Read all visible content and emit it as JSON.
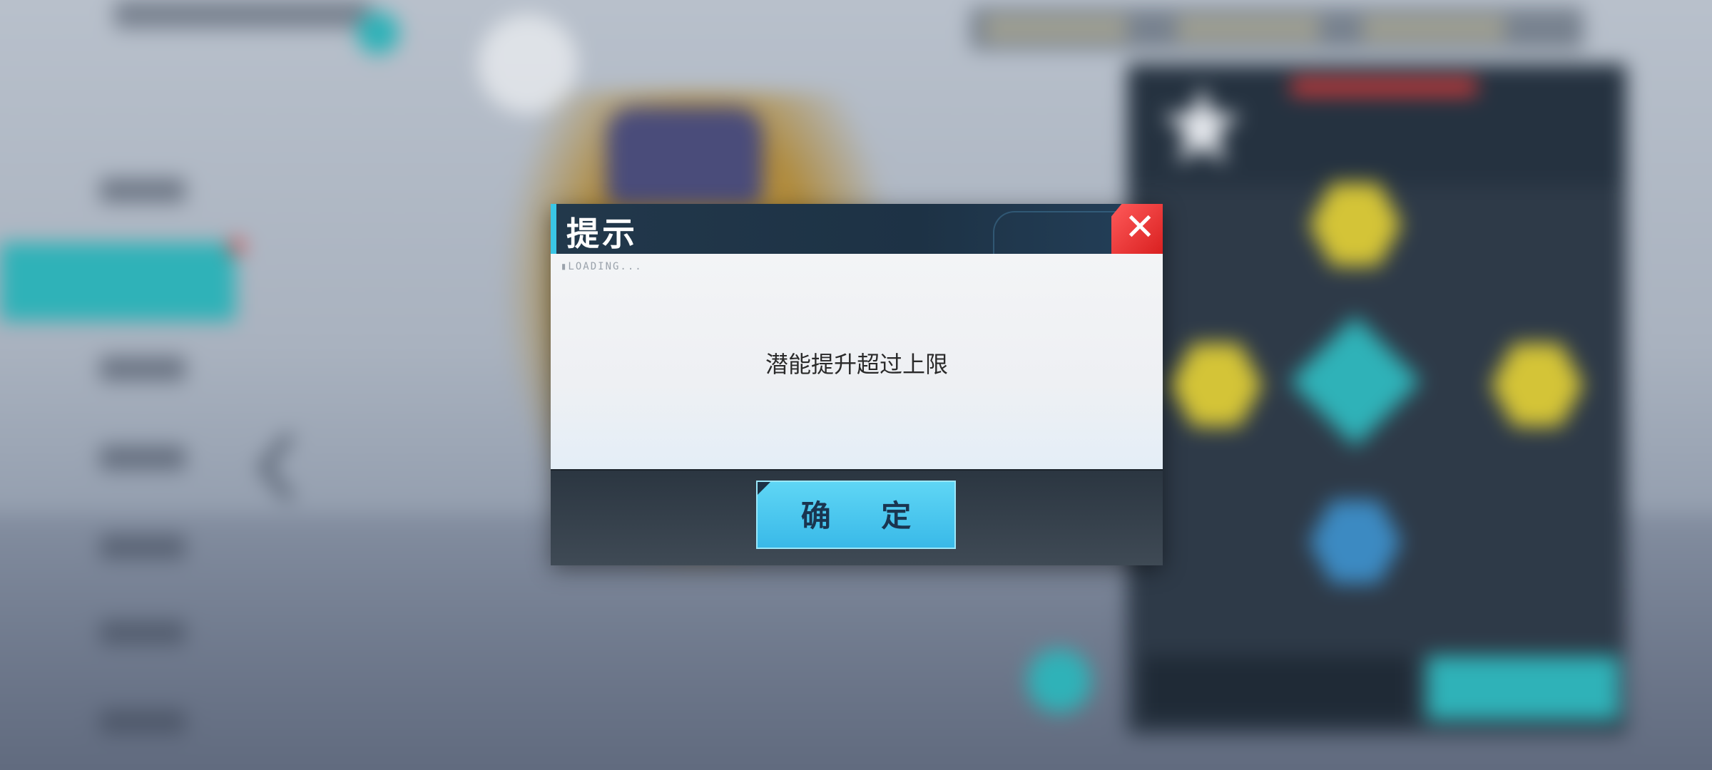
{
  "dialog": {
    "title": "提示",
    "subtitle": "",
    "loading_text": "▮LOADING...",
    "message": "潜能提升超过上限",
    "close_icon": "close-icon",
    "confirm_label": "确 定",
    "confirm_sub": ""
  },
  "colors": {
    "accent": "#3ac6e6",
    "close": "#e02c2c",
    "header": "#1d3245",
    "button": "#4cc8ef"
  }
}
